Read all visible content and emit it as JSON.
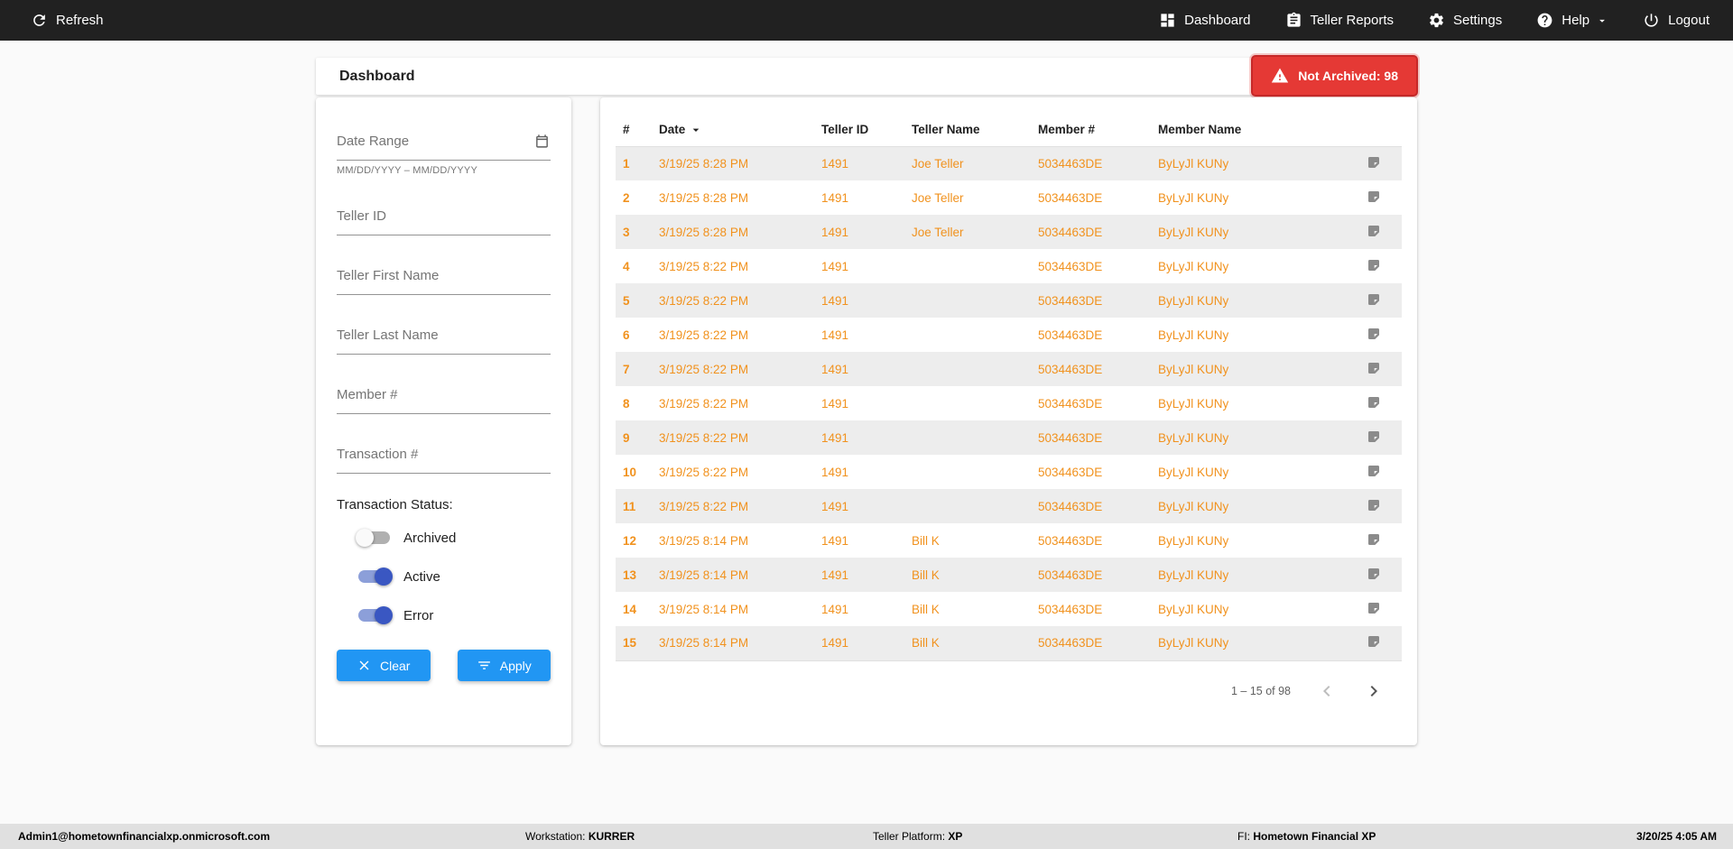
{
  "topnav": {
    "refresh_label": "Refresh",
    "items": [
      {
        "label": "Dashboard",
        "icon": "dashboard-icon"
      },
      {
        "label": "Teller Reports",
        "icon": "clipboard-icon"
      },
      {
        "label": "Settings",
        "icon": "gear-icon"
      },
      {
        "label": "Help",
        "icon": "help-icon",
        "has_chevron": true
      },
      {
        "label": "Logout",
        "icon": "power-icon"
      }
    ]
  },
  "header": {
    "title": "Dashboard",
    "badge": {
      "label": "Not Archived: 98",
      "icon": "warning-icon"
    }
  },
  "filters": {
    "fields": [
      {
        "placeholder": "Date Range",
        "hint": "MM/DD/YYYY – MM/DD/YYYY",
        "icon": "calendar-icon",
        "value": ""
      },
      {
        "placeholder": "Teller ID",
        "value": ""
      },
      {
        "placeholder": "Teller First Name",
        "value": ""
      },
      {
        "placeholder": "Teller Last Name",
        "value": ""
      },
      {
        "placeholder": "Member #",
        "value": ""
      },
      {
        "placeholder": "Transaction #",
        "value": ""
      }
    ],
    "status_label": "Transaction Status:",
    "toggles": [
      {
        "label": "Archived",
        "on": false
      },
      {
        "label": "Active",
        "on": true
      },
      {
        "label": "Error",
        "on": true
      }
    ],
    "clear_label": "Clear",
    "apply_label": "Apply"
  },
  "table": {
    "columns": [
      "#",
      "Date",
      "Teller ID",
      "Teller Name",
      "Member #",
      "Member Name"
    ],
    "sort_column": "Date",
    "sort_direction": "desc",
    "rows": [
      {
        "num": "1",
        "date": "3/19/25 8:28 PM",
        "teller_id": "1491",
        "teller_name": "Joe Teller",
        "member_num": "5034463DE",
        "member_name": "ByLyJl KUNy"
      },
      {
        "num": "2",
        "date": "3/19/25 8:28 PM",
        "teller_id": "1491",
        "teller_name": "Joe Teller",
        "member_num": "5034463DE",
        "member_name": "ByLyJl KUNy"
      },
      {
        "num": "3",
        "date": "3/19/25 8:28 PM",
        "teller_id": "1491",
        "teller_name": "Joe Teller",
        "member_num": "5034463DE",
        "member_name": "ByLyJl KUNy"
      },
      {
        "num": "4",
        "date": "3/19/25 8:22 PM",
        "teller_id": "1491",
        "teller_name": "",
        "member_num": "5034463DE",
        "member_name": "ByLyJl KUNy"
      },
      {
        "num": "5",
        "date": "3/19/25 8:22 PM",
        "teller_id": "1491",
        "teller_name": "",
        "member_num": "5034463DE",
        "member_name": "ByLyJl KUNy"
      },
      {
        "num": "6",
        "date": "3/19/25 8:22 PM",
        "teller_id": "1491",
        "teller_name": "",
        "member_num": "5034463DE",
        "member_name": "ByLyJl KUNy"
      },
      {
        "num": "7",
        "date": "3/19/25 8:22 PM",
        "teller_id": "1491",
        "teller_name": "",
        "member_num": "5034463DE",
        "member_name": "ByLyJl KUNy"
      },
      {
        "num": "8",
        "date": "3/19/25 8:22 PM",
        "teller_id": "1491",
        "teller_name": "",
        "member_num": "5034463DE",
        "member_name": "ByLyJl KUNy"
      },
      {
        "num": "9",
        "date": "3/19/25 8:22 PM",
        "teller_id": "1491",
        "teller_name": "",
        "member_num": "5034463DE",
        "member_name": "ByLyJl KUNy"
      },
      {
        "num": "10",
        "date": "3/19/25 8:22 PM",
        "teller_id": "1491",
        "teller_name": "",
        "member_num": "5034463DE",
        "member_name": "ByLyJl KUNy"
      },
      {
        "num": "11",
        "date": "3/19/25 8:22 PM",
        "teller_id": "1491",
        "teller_name": "",
        "member_num": "5034463DE",
        "member_name": "ByLyJl KUNy"
      },
      {
        "num": "12",
        "date": "3/19/25 8:14 PM",
        "teller_id": "1491",
        "teller_name": "Bill K",
        "member_num": "5034463DE",
        "member_name": "ByLyJl KUNy"
      },
      {
        "num": "13",
        "date": "3/19/25 8:14 PM",
        "teller_id": "1491",
        "teller_name": "Bill K",
        "member_num": "5034463DE",
        "member_name": "ByLyJl KUNy"
      },
      {
        "num": "14",
        "date": "3/19/25 8:14 PM",
        "teller_id": "1491",
        "teller_name": "Bill K",
        "member_num": "5034463DE",
        "member_name": "ByLyJl KUNy"
      },
      {
        "num": "15",
        "date": "3/19/25 8:14 PM",
        "teller_id": "1491",
        "teller_name": "Bill K",
        "member_num": "5034463DE",
        "member_name": "ByLyJl KUNy"
      }
    ],
    "pagination": {
      "range": "1 – 15 of 98"
    }
  },
  "footer": {
    "user": "Admin1@hometownfinancialxp.onmicrosoft.com",
    "workstation_label": "Workstation:",
    "workstation_value": "KURRER",
    "platform_label": "Teller Platform:",
    "platform_value": "XP",
    "fi_label": "FI:",
    "fi_value": "Hometown Financial XP",
    "datetime": "3/20/25 4:05 AM"
  },
  "colors": {
    "navbar_bg": "#212121",
    "accent_blue": "#2196f3",
    "row_text_orange": "#f1921e",
    "badge_red": "#e53935",
    "toggle_on_blue": "#3a57c2",
    "footer_bg": "#e0e0e0"
  },
  "icons": {
    "refresh": "circular-arrow",
    "dashboard": "grid-squares",
    "teller_reports": "clipboard",
    "settings": "gear",
    "help": "question-circle",
    "logout": "power",
    "warning": "triangle-exclamation",
    "calendar": "calendar",
    "sort": "caret-down",
    "note": "sticky-note",
    "clear": "x-mark",
    "apply": "filter-lines",
    "prev_page": "chevron-left",
    "next_page": "chevron-right"
  }
}
